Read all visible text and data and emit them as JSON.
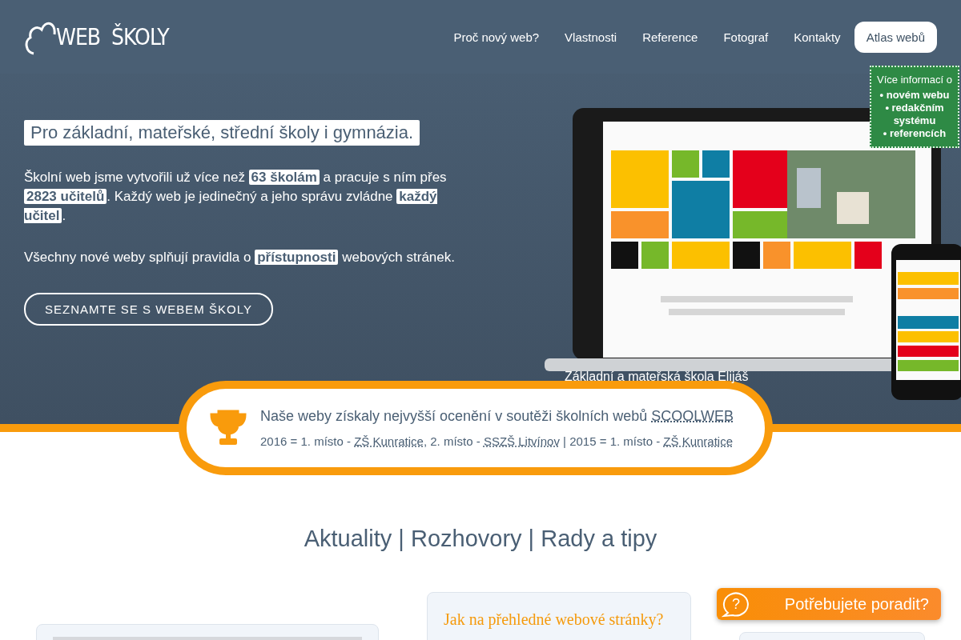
{
  "logo": {
    "word1": "WEB",
    "word2": "ŠKOLY"
  },
  "nav": [
    {
      "label": "Proč nový web?",
      "selected": false
    },
    {
      "label": "Vlastnosti",
      "selected": false
    },
    {
      "label": "Reference",
      "selected": false
    },
    {
      "label": "Fotograf",
      "selected": false
    },
    {
      "label": "Kontakty",
      "selected": false
    },
    {
      "label": "Atlas webů",
      "selected": true
    }
  ],
  "info_box": {
    "title": "Více informací o",
    "items": [
      "• novém webu",
      "• redakčním systému",
      "• referencích"
    ]
  },
  "hero": {
    "tagline": "Pro základní, mateřské, střední školy i gymnázia.",
    "paragraphs": [
      "Školní web jsme vytvořili už více než **63 školám** a pracuje s ním přes **2823 učitelů**. Každý web je jedinečný a jeho správu zvládne **každý učitel**.",
      "Všechny nové weby splňují pravidla o **přístupnosti** webových stránek."
    ],
    "button": "SEZNAMTE SE S WEBEM ŠKOLY",
    "caption": "Základní a mateřská škola Elijáš"
  },
  "award": {
    "headline": "Naše weby získaly nejvyšší ocenění v soutěži školních webů",
    "headline_link": "SCOOLWEB",
    "parts": [
      {
        "kind": "text",
        "text": "2016 = 1. místo - "
      },
      {
        "kind": "link",
        "text": "ZŠ Kunratice"
      },
      {
        "kind": "text",
        "text": ", 2. místo - "
      },
      {
        "kind": "link",
        "text": "SSZŠ Litvínov"
      },
      {
        "kind": "text",
        "text": " | 2015 = 1. místo - "
      },
      {
        "kind": "link",
        "text": "ZŠ Kunratice"
      }
    ]
  },
  "section_title": "Aktuality | Rozhovory | Rady a tipy",
  "article_title": "Jak na přehledné webové stránky?",
  "help_icon": "?",
  "help_button": "Potřebujete poradit?"
}
